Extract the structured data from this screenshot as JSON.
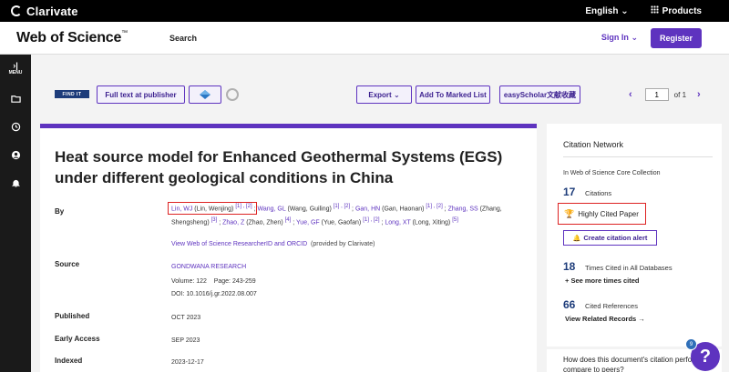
{
  "topbar": {
    "brand": "Clarivate",
    "language": "English",
    "products": "Products"
  },
  "header": {
    "logo": "Web of Science",
    "logo_tm": "™",
    "search": "Search",
    "signin": "Sign In",
    "register": "Register"
  },
  "sidebar": {
    "menu_label": "MENU",
    "icons": [
      "folder-icon",
      "history-icon",
      "user-icon",
      "bell-icon"
    ]
  },
  "toolbar": {
    "findit": "FIND IT",
    "fulltext": "Full text at publisher",
    "export": "Export",
    "marked_list": "Add To Marked List",
    "easyscholar": "easyScholar文献收藏",
    "page_value": "1",
    "page_of": "of 1"
  },
  "record": {
    "title": "Heat source model for Enhanced Geothermal Systems (EGS) under different geological conditions in China",
    "labels": {
      "by": "By",
      "source": "Source",
      "published": "Published",
      "early_access": "Early Access",
      "indexed": "Indexed"
    },
    "authors": [
      {
        "short": "Lin, WJ",
        "full": " (Lin, Wenjing)",
        "refs": "[1] , [2]",
        "sep": " ; "
      },
      {
        "short": "Wang, GL",
        "full": " (Wang, Guiling)",
        "refs": "[1] , [2]",
        "sep": " ; "
      },
      {
        "short": "Gan, HN",
        "full": " (Gan, Haonan)",
        "refs": "[1] , [2]",
        "sep": " ; "
      },
      {
        "short": "Zhang, SS",
        "full": " (Zhang, Shengsheng)",
        "refs": "[3]",
        "sep": " ; "
      },
      {
        "short": "Zhao, Z",
        "full": " (Zhao, Zhen)",
        "refs": "[4]",
        "sep": " ; "
      },
      {
        "short": "Yue, GF",
        "full": " (Yue, Gaofan)",
        "refs": "[1] , [2]",
        "sep": " ; "
      },
      {
        "short": "Long, XT",
        "full": " (Long, Xiting)",
        "refs": "[5]",
        "sep": ""
      }
    ],
    "researcher_link": "View Web of Science ResearcherID and ORCID",
    "researcher_note": "(provided by Clarivate)",
    "source_name": "GONDWANA RESEARCH",
    "volume": "Volume: 122",
    "pages": "Page: 243-259",
    "doi": "DOI: 10.1016/j.gr.2022.08.007",
    "published": "OCT 2023",
    "early_access": "SEP 2023",
    "indexed": "2023-12-17"
  },
  "citation": {
    "title": "Citation Network",
    "collection": "In Web of Science Core Collection",
    "citations_count": "17",
    "citations_label": "Citations",
    "highly_cited": "Highly Cited Paper",
    "alert": "Create citation alert",
    "times_cited_count": "18",
    "times_cited_label": "Times Cited in All Databases",
    "see_more": "+ See more times cited",
    "refs_count": "66",
    "refs_label": "Cited References",
    "view_refs": "View Related Records →",
    "question": "How does this document's citation performance compare to peers?"
  },
  "help": {
    "badge": "9",
    "symbol": "?"
  }
}
